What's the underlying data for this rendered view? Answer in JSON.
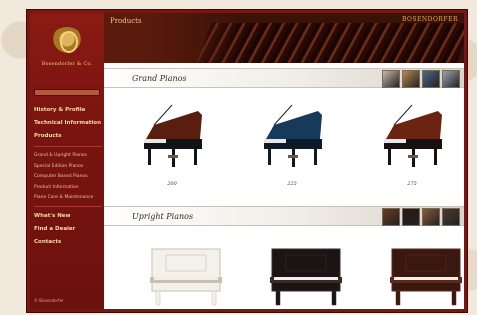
{
  "header": {
    "title": "Products",
    "brand": "BOSENDORFER"
  },
  "logo": {
    "text": "Bosendorfer & Co."
  },
  "sidebar": {
    "items": [
      {
        "label": "History & Profile",
        "type": "main"
      },
      {
        "label": "Technical Information",
        "type": "main"
      },
      {
        "label": "Products",
        "type": "main"
      },
      {
        "label": "Grand & Upright Pianos",
        "type": "sub"
      },
      {
        "label": "Special Edition Pianos",
        "type": "sub"
      },
      {
        "label": "Computer Based Pianos",
        "type": "sub"
      },
      {
        "label": "Product Information",
        "type": "sub"
      },
      {
        "label": "Piano Care & Maintenance",
        "type": "sub"
      },
      {
        "label": "What's New",
        "type": "main"
      },
      {
        "label": "Find a Dealer",
        "type": "main"
      },
      {
        "label": "Contacts",
        "type": "main"
      }
    ],
    "footer": "© Bosendorfer"
  },
  "sections": {
    "grand": {
      "title": "Grand Pianos",
      "pianos": [
        {
          "label": "200",
          "lid_color": "#5a1e10",
          "body_color": "#101418"
        },
        {
          "label": "225",
          "lid_color": "#183a5a",
          "body_color": "#0d1a28"
        },
        {
          "label": "275",
          "lid_color": "#6a2412",
          "body_color": "#181010"
        }
      ],
      "thumb_colors": [
        "#c8b9a5",
        "#b88a4a",
        "#4a6a8a",
        "#9aa5b0"
      ]
    },
    "upright": {
      "title": "Upright Pianos",
      "pianos": [
        {
          "label": "",
          "color": "#f4f1ea",
          "accent": "#c8c0b0"
        },
        {
          "label": "",
          "color": "#1a1414",
          "accent": "#3a2a22"
        },
        {
          "label": "",
          "color": "#3a1810",
          "accent": "#5a2a1a"
        }
      ],
      "thumb_colors": [
        "#6a3a22",
        "#2a1a14",
        "#8a5a3a",
        "#4a3a32"
      ]
    }
  }
}
